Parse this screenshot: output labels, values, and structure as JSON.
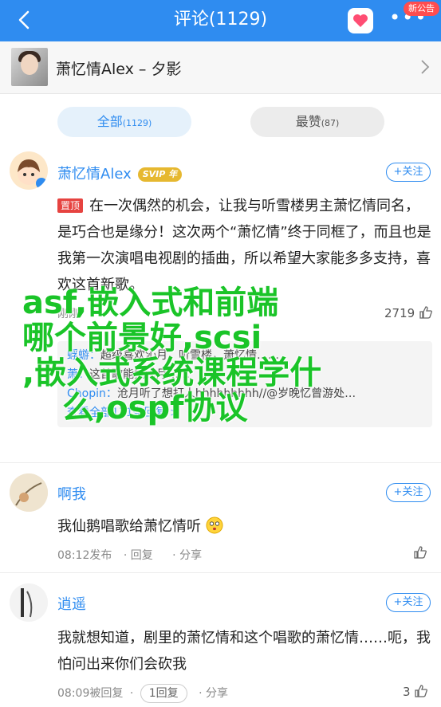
{
  "topbar": {
    "title": "评论(1129)",
    "badge": "新公告",
    "more": "•••"
  },
  "song": {
    "title": "萧忆情Alex – 夕影"
  },
  "tabs": [
    {
      "label": "全部",
      "count": "(1129)"
    },
    {
      "label": "最赞",
      "count": "(87)"
    }
  ],
  "comments": [
    {
      "user": "萧忆情Alex",
      "badge": "SVIP",
      "badge_extra": "年",
      "follow": "+关注",
      "pin": "置顶",
      "text": "在一次偶然的机会，让我与听雪楼男主萧忆情同名，是巧合也是缘分！这次两个“萧忆情”终于同框了，而且也是我第一次演唱电视剧的插曲，所以希望大家能多多支持，喜欢这首新歌。",
      "meta_time": "刚刚",
      "likes": "2719",
      "replies": [
        {
          "name": "蜉蝣：",
          "text": "超级喜欢沁月，听雪楼，萧忆情……"
        },
        {
          "name": "萧：",
          "text": "这首歌能把沁月……"
        },
        {
          "name": "Chopin：",
          "text": "沧月听了想打人hhhhhhhhh//@岁晚忆曾游处…"
        }
      ],
      "reply_more": "查看全部171条回复 >"
    },
    {
      "user": "啊我",
      "follow": "+关注",
      "text": "我仙鹅唱歌给萧忆情听",
      "meta_time": "08:12发布",
      "reply": "回复",
      "share": "分享",
      "likes": ""
    },
    {
      "user": "逍遥",
      "follow": "+关注",
      "text": "我就想知道，剧里的萧忆情和这个唱歌的萧忆情……呃，我怕问出来你们会砍我",
      "meta_time": "08:09被回复",
      "reply": "1回复",
      "share": "分享",
      "likes": "3"
    }
  ],
  "overlay_lines": [
    "asf,嵌入式和前端",
    "哪个前景好,scsi",
    ",嵌入式系统课程学什",
    "么,ospf协议"
  ],
  "colors": {
    "brand": "#2f8cf0",
    "overlay": "#1ac428",
    "pin": "#e64340"
  }
}
